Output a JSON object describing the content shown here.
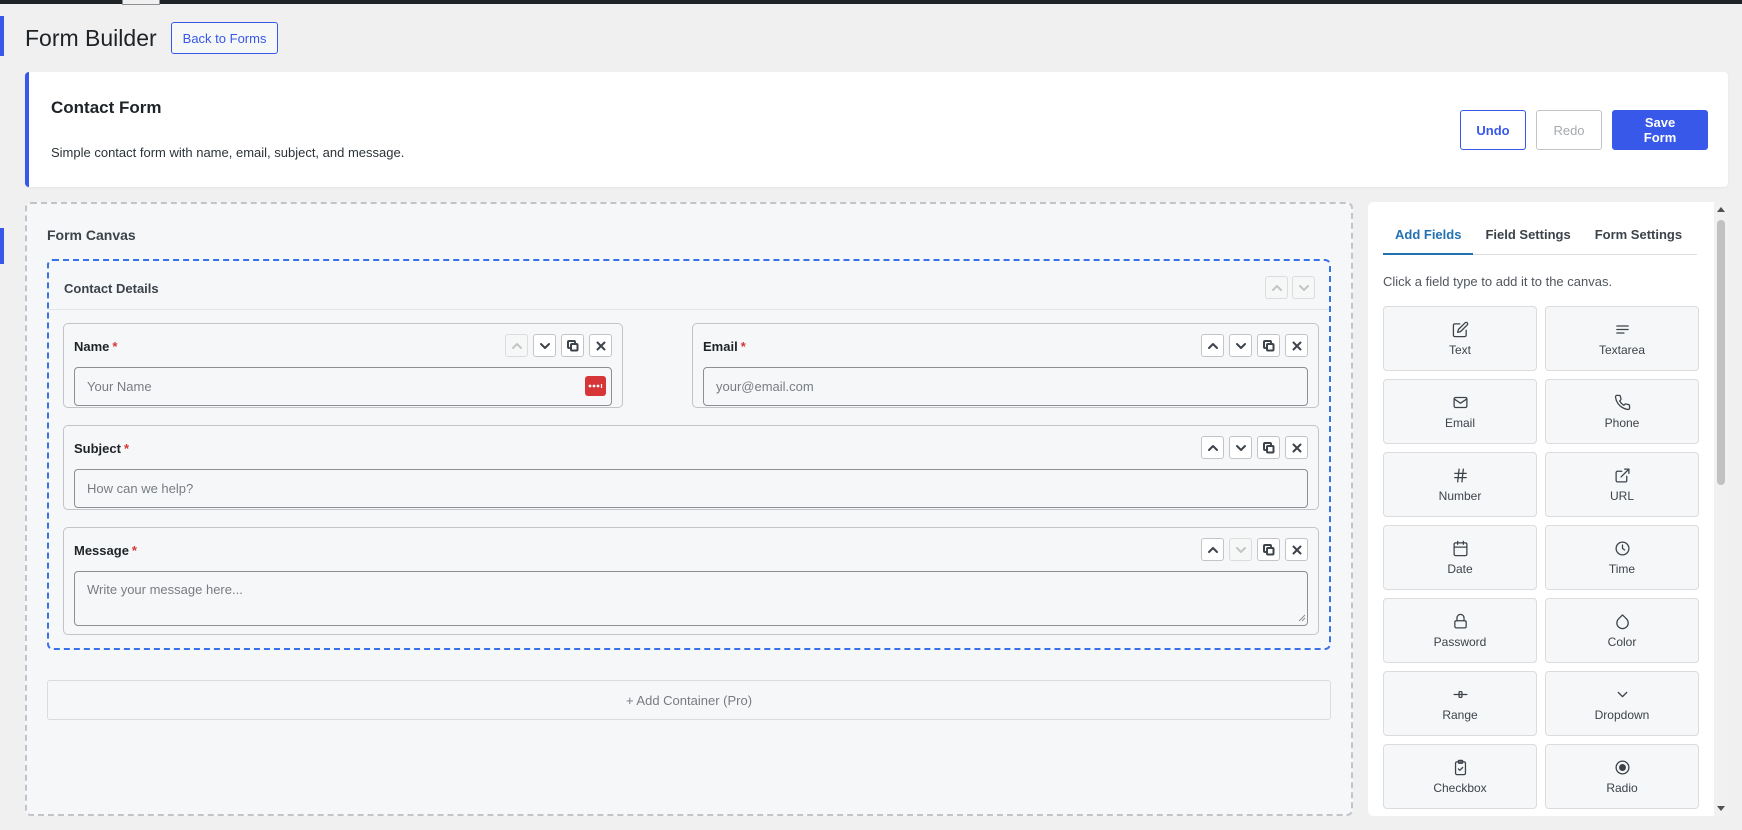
{
  "page": {
    "title": "Form Builder",
    "back_label": "Back to Forms"
  },
  "form": {
    "title": "Contact Form",
    "description": "Simple contact form with name, email, subject, and message.",
    "undo_label": "Undo",
    "redo_label": "Redo",
    "save_label": "Save Form"
  },
  "canvas": {
    "title": "Form Canvas",
    "container": {
      "title": "Contact Details",
      "fields": [
        {
          "label": "Name",
          "required": "*",
          "placeholder": "Your Name"
        },
        {
          "label": "Email",
          "required": "*",
          "placeholder": "your@email.com"
        },
        {
          "label": "Subject",
          "required": "*",
          "placeholder": "How can we help?"
        },
        {
          "label": "Message",
          "required": "*",
          "placeholder": "Write your message here..."
        }
      ]
    },
    "add_container_label": "+ Add Container (Pro)"
  },
  "panel": {
    "tabs": [
      {
        "label": "Add Fields",
        "active": true
      },
      {
        "label": "Field Settings",
        "active": false
      },
      {
        "label": "Form Settings",
        "active": false
      }
    ],
    "hint": "Click a field type to add it to the canvas.",
    "tiles": [
      {
        "label": "Text",
        "icon": "edit-icon"
      },
      {
        "label": "Textarea",
        "icon": "lines-icon"
      },
      {
        "label": "Email",
        "icon": "mail-icon"
      },
      {
        "label": "Phone",
        "icon": "phone-icon"
      },
      {
        "label": "Number",
        "icon": "hash-icon"
      },
      {
        "label": "URL",
        "icon": "external-link-icon"
      },
      {
        "label": "Date",
        "icon": "calendar-icon"
      },
      {
        "label": "Time",
        "icon": "clock-icon"
      },
      {
        "label": "Password",
        "icon": "lock-icon"
      },
      {
        "label": "Color",
        "icon": "droplet-icon"
      },
      {
        "label": "Range",
        "icon": "slider-icon"
      },
      {
        "label": "Dropdown",
        "icon": "chevron-down-icon"
      },
      {
        "label": "Checkbox",
        "icon": "clipboard-check-icon"
      },
      {
        "label": "Radio",
        "icon": "radio-icon"
      }
    ]
  },
  "colors": {
    "accent": "#3858e9",
    "tab_active": "#2271b1",
    "required": "#d63638",
    "container_border": "#3872e8"
  }
}
